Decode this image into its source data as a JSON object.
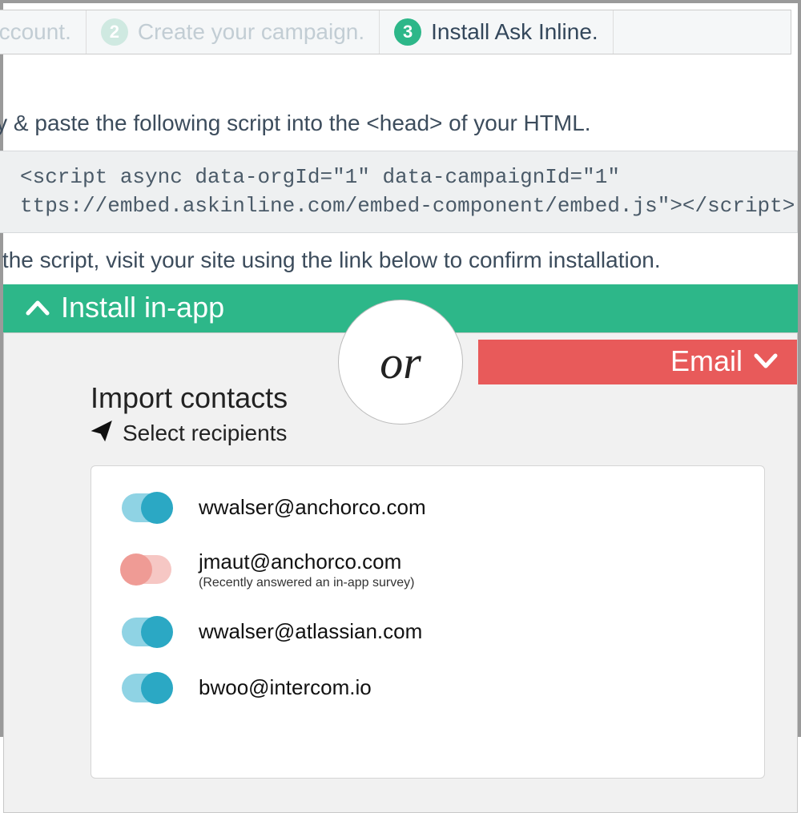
{
  "wizard": {
    "step1_label": "account.",
    "step2_num": "2",
    "step2_label": "Create your campaign.",
    "step3_num": "3",
    "step3_label": "Install Ask Inline."
  },
  "install": {
    "instruction1": "opy & paste the following script into the <head> of your HTML.",
    "code_line1": "<script async data-orgId=\"1\" data-campaignId=\"1\"",
    "code_line2": "ttps://embed.askinline.com/embed-component/embed.js\"></scr",
    "code_line2_suffix": "ipt>",
    "instruction2": "ng the script, visit your site using the link below to confirm installation.",
    "green_label": "Install in-app"
  },
  "divider": {
    "or": "or"
  },
  "email": {
    "red_label": "Email",
    "import_title": "Import contacts",
    "select_label": "Select recipients"
  },
  "contacts": [
    {
      "email": "wwalser@anchorco.com",
      "note": "",
      "on": true
    },
    {
      "email": "jmaut@anchorco.com",
      "note": "(Recently answered an in-app survey)",
      "on": false
    },
    {
      "email": "wwalser@atlassian.com",
      "note": "",
      "on": true
    },
    {
      "email": "bwoo@intercom.io",
      "note": "",
      "on": true
    }
  ]
}
